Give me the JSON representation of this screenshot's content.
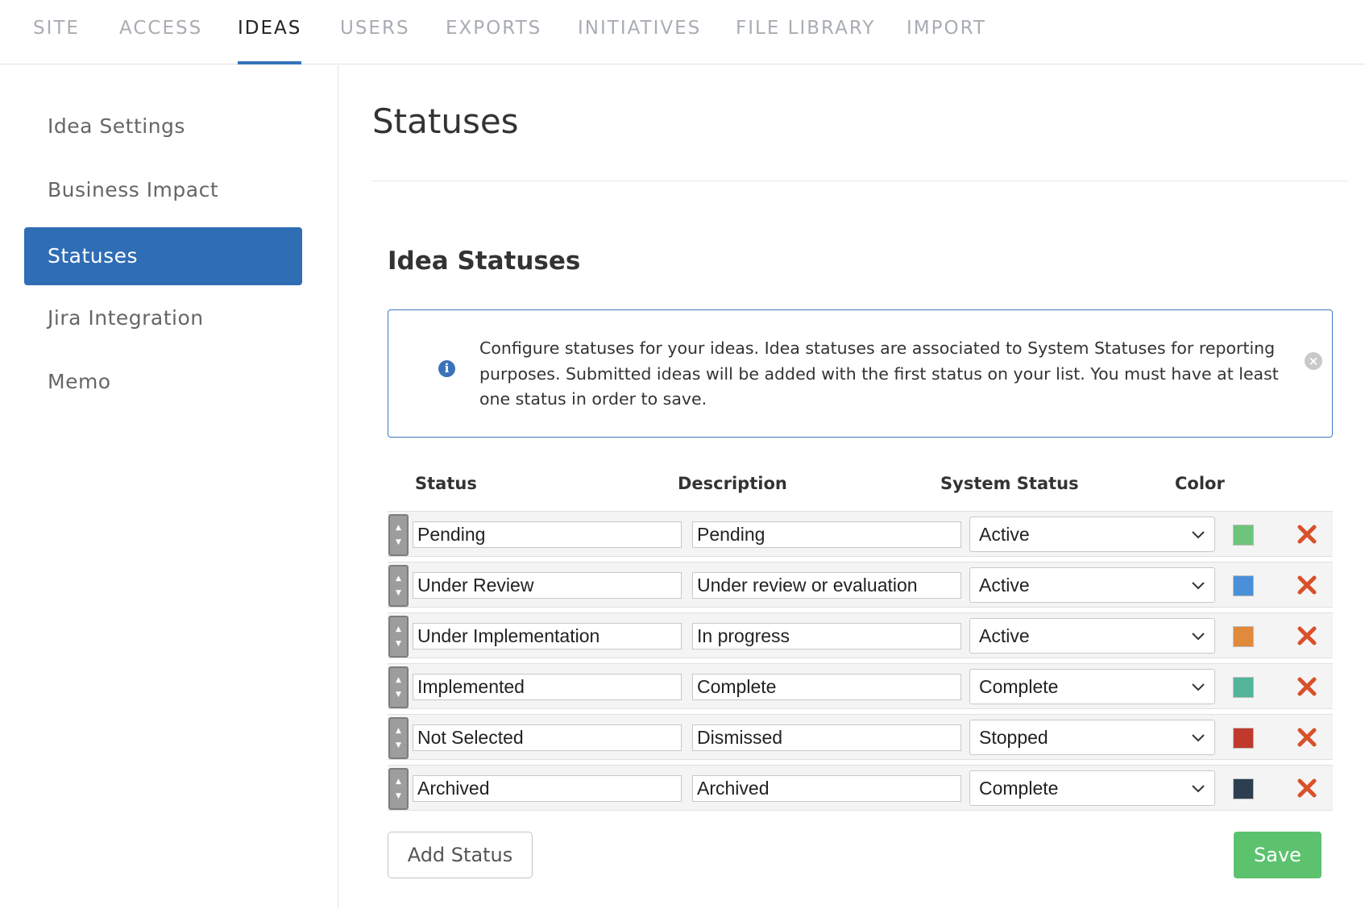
{
  "top_nav": {
    "tabs": [
      {
        "label": "SITE",
        "active": false
      },
      {
        "label": "ACCESS",
        "active": false
      },
      {
        "label": "IDEAS",
        "active": true
      },
      {
        "label": "USERS",
        "active": false
      },
      {
        "label": "EXPORTS",
        "active": false
      },
      {
        "label": "INITIATIVES",
        "active": false
      },
      {
        "label": "FILE LIBRARY",
        "active": false
      },
      {
        "label": "IMPORT",
        "active": false
      }
    ]
  },
  "sidebar": {
    "items": [
      {
        "label": "Idea Settings",
        "active": false
      },
      {
        "label": "Business Impact",
        "active": false
      },
      {
        "label": "Statuses",
        "active": true
      },
      {
        "label": "Jira Integration",
        "active": false
      },
      {
        "label": "Memo",
        "active": false
      }
    ]
  },
  "main": {
    "page_title": "Statuses",
    "section_title": "Idea Statuses",
    "info": {
      "text": "Configure statuses for your ideas. Idea statuses are associated to System Statuses for reporting purposes. Submitted ideas will be added with the first status on your list. You must have at least one status in order to save.",
      "icon": "info-icon",
      "close_icon": "close-circle-icon"
    },
    "table": {
      "headers": {
        "status": "Status",
        "description": "Description",
        "system_status": "System Status",
        "color": "Color"
      },
      "rows": [
        {
          "status": "Pending",
          "description": "Pending",
          "system_status": "Active",
          "color": "#6cc57a"
        },
        {
          "status": "Under Review",
          "description": "Under review or evaluation",
          "system_status": "Active",
          "color": "#4a90d9"
        },
        {
          "status": "Under Implementation",
          "description": "In progress",
          "system_status": "Active",
          "color": "#e08a3c"
        },
        {
          "status": "Implemented",
          "description": "Complete",
          "system_status": "Complete",
          "color": "#52b59a"
        },
        {
          "status": "Not Selected",
          "description": "Dismissed",
          "system_status": "Stopped",
          "color": "#c0392b"
        },
        {
          "status": "Archived",
          "description": "Archived",
          "system_status": "Complete",
          "color": "#2c3e50"
        }
      ]
    },
    "add_button": "Add Status",
    "save_button": "Save"
  },
  "colors": {
    "accent": "#2f6db5",
    "save": "#5cc26e",
    "delete": "#d9502a"
  }
}
